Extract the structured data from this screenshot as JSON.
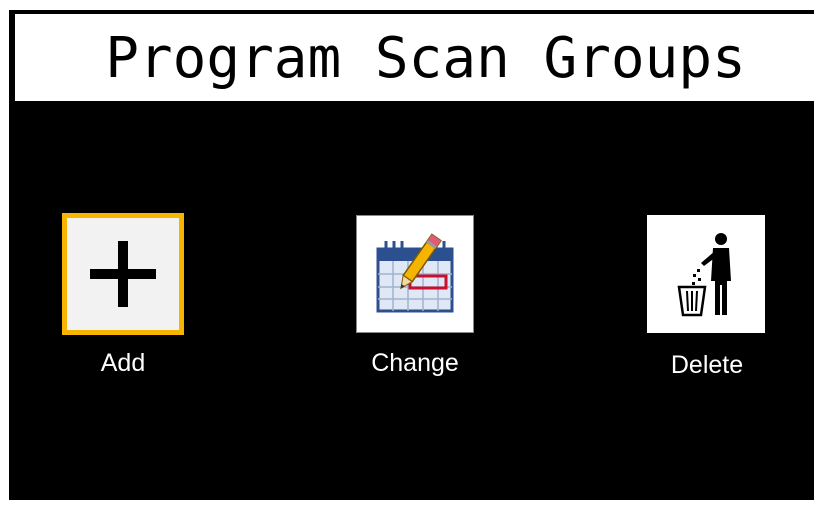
{
  "title": "Program Scan Groups",
  "actions": [
    {
      "id": "add",
      "label": "Add",
      "icon": "plus-icon",
      "selected": true
    },
    {
      "id": "change",
      "label": "Change",
      "icon": "calendar-edit-icon",
      "selected": false
    },
    {
      "id": "delete",
      "label": "Delete",
      "icon": "trash-person-icon",
      "selected": false
    }
  ],
  "colors": {
    "background": "#000000",
    "title_bg": "#ffffff",
    "selection": "#f7b500",
    "label": "#ffffff"
  }
}
